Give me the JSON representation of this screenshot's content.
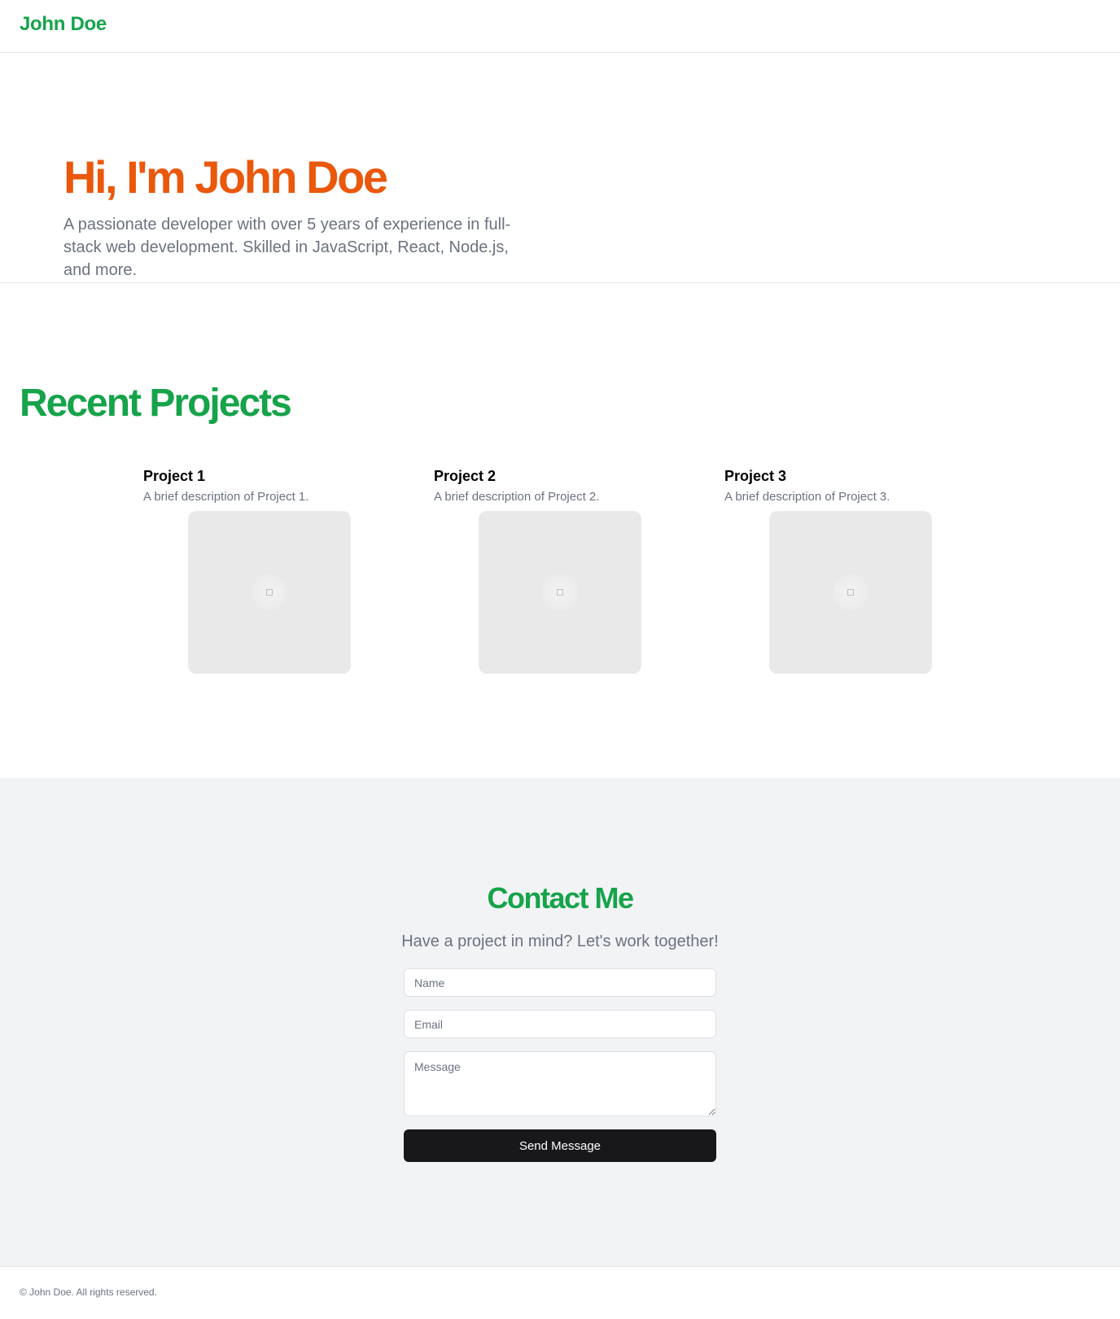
{
  "header": {
    "brand": "John Doe"
  },
  "hero": {
    "title": "Hi, I'm John Doe",
    "intro": "A passionate developer with over 5 years of experience in full-stack web development. Skilled in JavaScript, React, Node.js, and more."
  },
  "projects": {
    "heading": "Recent Projects",
    "items": [
      {
        "title": "Project 1",
        "description": "A brief description of Project 1.",
        "image_icon": "image-placeholder-icon"
      },
      {
        "title": "Project 2",
        "description": "A brief description of Project 2.",
        "image_icon": "image-placeholder-icon"
      },
      {
        "title": "Project 3",
        "description": "A brief description of Project 3.",
        "image_icon": "image-placeholder-icon"
      }
    ]
  },
  "contact": {
    "heading": "Contact Me",
    "lead": "Have a project in mind? Let's work together!",
    "name_placeholder": "Name",
    "name_value": "",
    "email_placeholder": "Email",
    "email_value": "",
    "message_placeholder": "Message",
    "message_value": "",
    "submit_label": "Send Message"
  },
  "footer": {
    "text": "© John Doe. All rights reserved."
  },
  "colors": {
    "green": "#16a34a",
    "orange": "#ea580c",
    "muted": "#6b7280",
    "button": "#18181b",
    "section_bg": "#f2f3f5"
  }
}
